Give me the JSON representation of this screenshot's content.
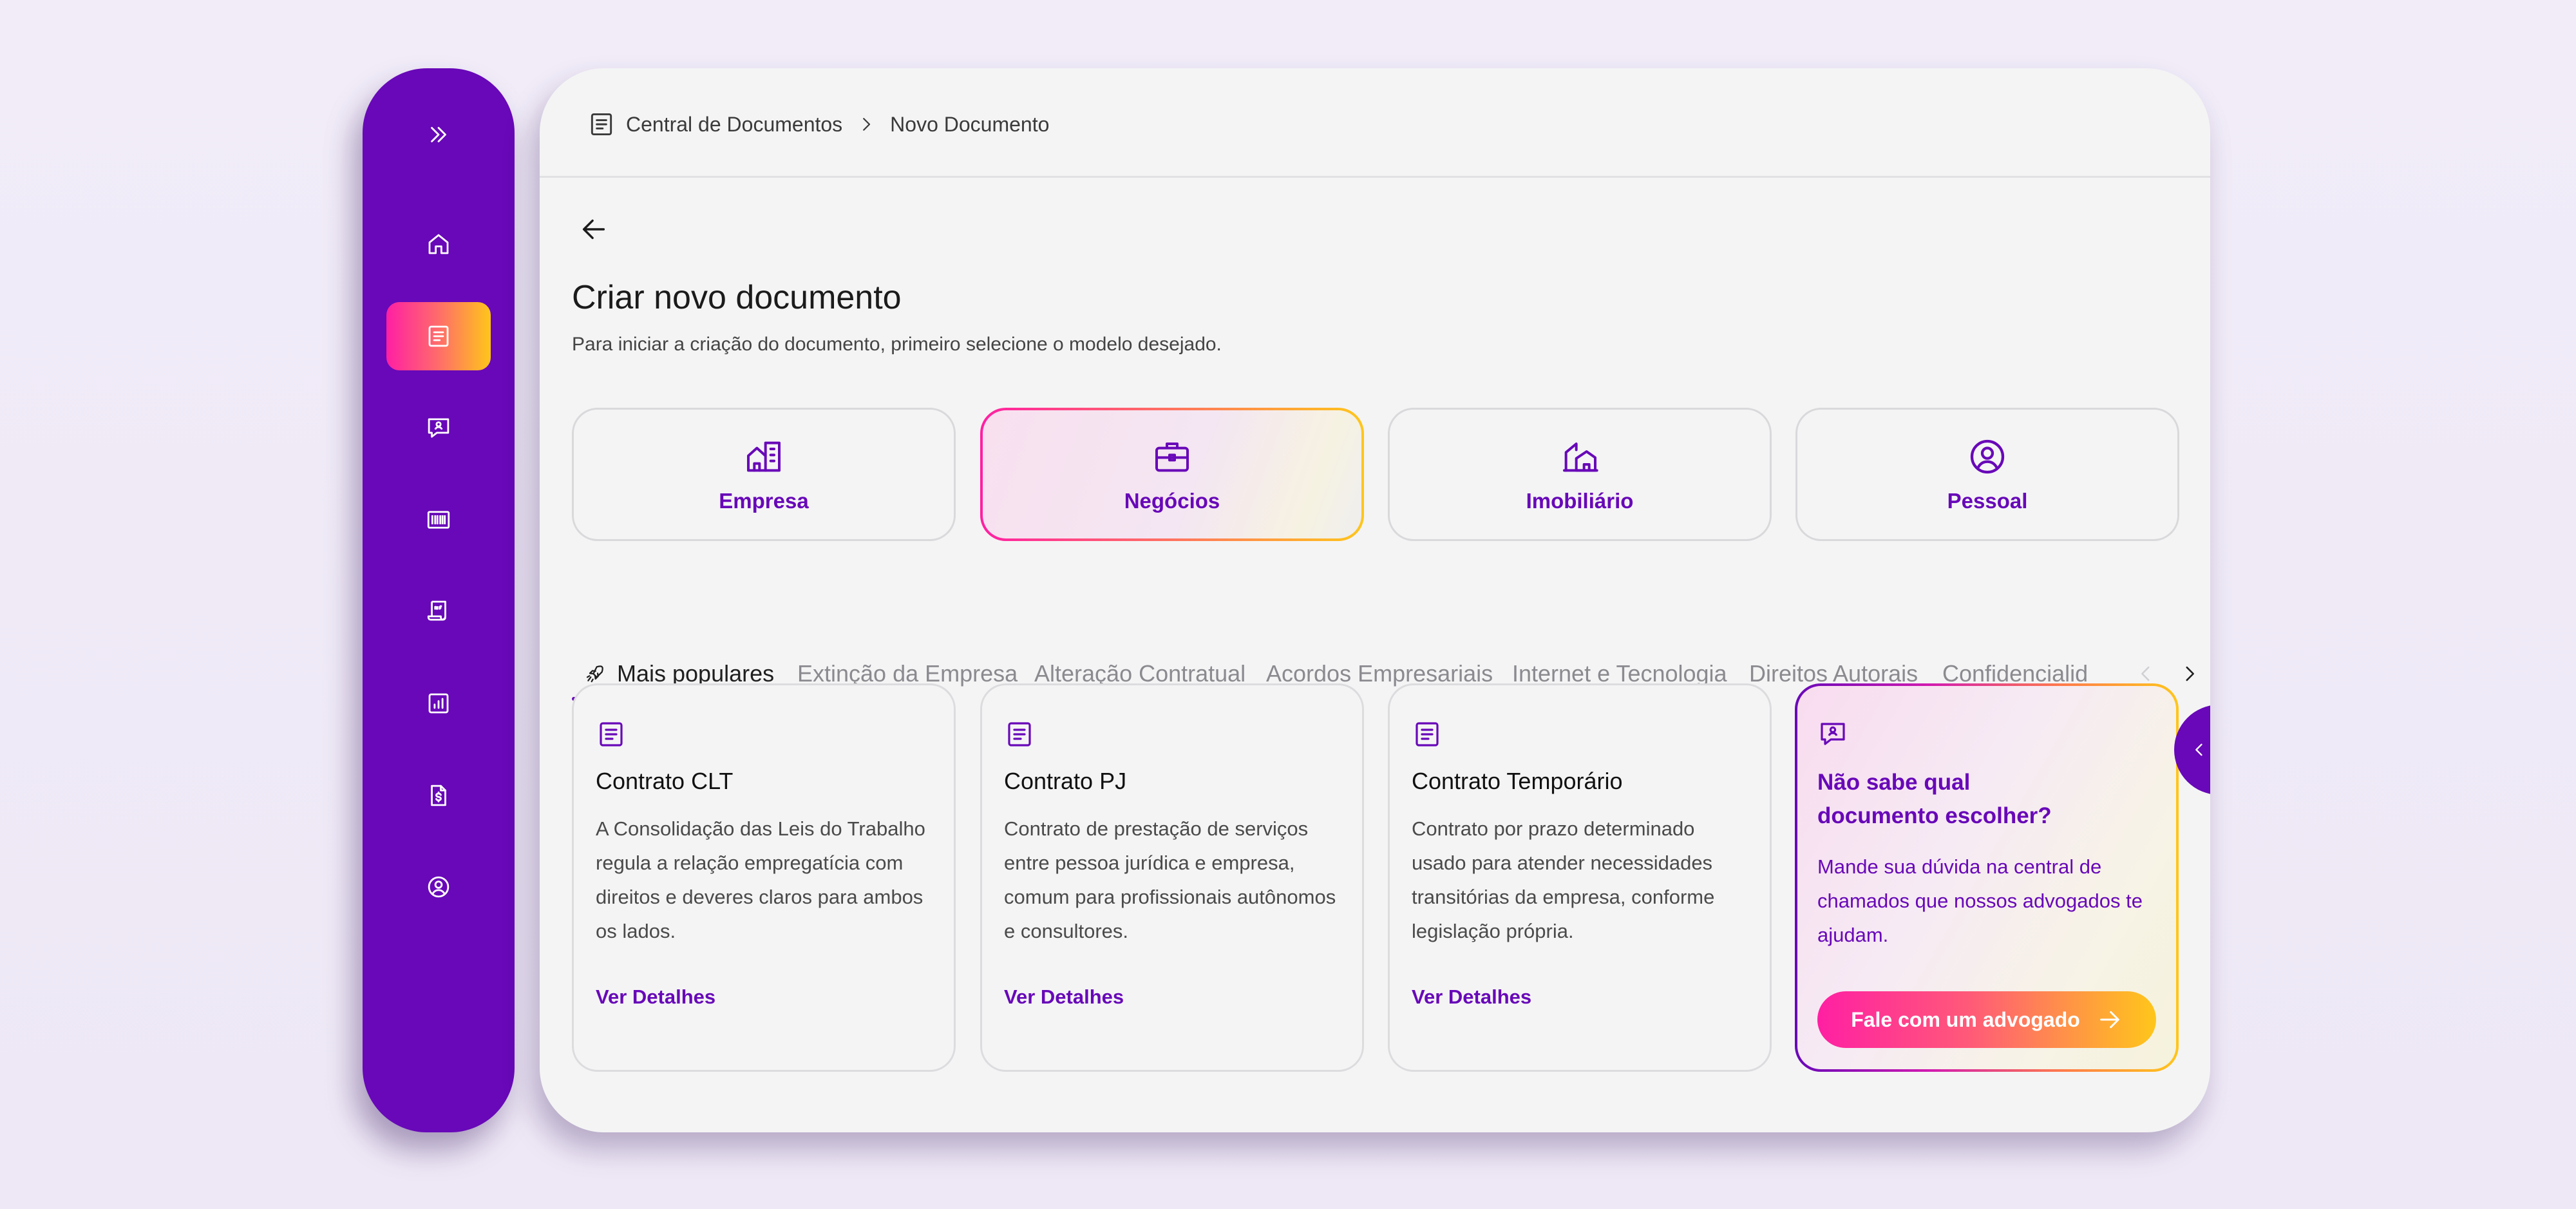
{
  "colors": {
    "brand_purple": "#6808b8",
    "gradient_start": "#ff1fa3",
    "gradient_end": "#ffc61a",
    "panel_bg": "#f4f4f5",
    "page_bg": "#f1ecf8"
  },
  "sidebar": {
    "items": [
      {
        "icon": "expand-chevrons-icon"
      },
      {
        "icon": "home-icon"
      },
      {
        "icon": "document-icon",
        "active": true
      },
      {
        "icon": "chat-user-icon"
      },
      {
        "icon": "barcode-icon"
      },
      {
        "icon": "invoice-nf-icon"
      },
      {
        "icon": "report-chart-icon"
      },
      {
        "icon": "money-file-icon"
      },
      {
        "icon": "user-circle-icon"
      }
    ]
  },
  "breadcrumb": {
    "icon": "document-icon",
    "root": "Central de Documentos",
    "current": "Novo Documento"
  },
  "header": {
    "title": "Criar novo documento",
    "subtitle": "Para iniciar a criação do documento, primeiro selecione o modelo desejado."
  },
  "categories": [
    {
      "label": "Empresa",
      "icon": "building-icon"
    },
    {
      "label": "Negócios",
      "icon": "briefcase-icon",
      "selected": true
    },
    {
      "label": "Imobiliário",
      "icon": "house-icon"
    },
    {
      "label": "Pessoal",
      "icon": "user-circle-icon"
    }
  ],
  "tabs": [
    {
      "label": "Mais populares",
      "icon": "rocket-icon",
      "active": true
    },
    {
      "label": "Extinção da Empresa"
    },
    {
      "label": "Alteração Contratual"
    },
    {
      "label": "Acordos Empresariais"
    },
    {
      "label": "Internet e Tecnologia"
    },
    {
      "label": "Direitos Autorais"
    },
    {
      "label": "Confidencialid"
    }
  ],
  "documents": [
    {
      "title": "Contrato CLT",
      "description": "A Consolidação das Leis do Trabalho regula a relação empregatícia com direitos e deveres claros para ambos os lados.",
      "link": "Ver Detalhes"
    },
    {
      "title": "Contrato PJ",
      "description": "Contrato de prestação de serviços entre pessoa jurídica e empresa, comum para profissionais autônomos e consultores.",
      "link": "Ver Detalhes"
    },
    {
      "title": "Contrato Temporário",
      "description": "Contrato por prazo determinado usado para atender necessidades transitórias da empresa, conforme legislação própria.",
      "link": "Ver Detalhes"
    }
  ],
  "help": {
    "title": "Não sabe qual documento escolher?",
    "description": "Mande sua dúvida na central de chamados que  nossos advogados te ajudam.",
    "button": "Fale com um advogado"
  }
}
